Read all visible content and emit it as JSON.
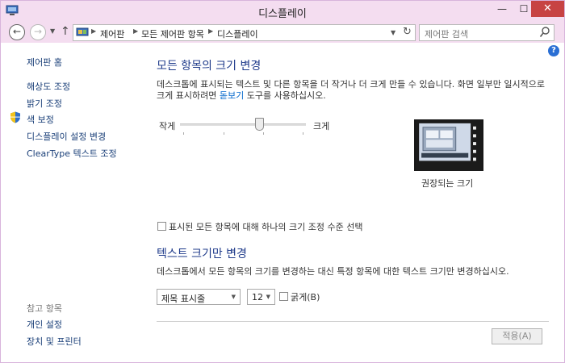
{
  "window": {
    "title": "디스플레이"
  },
  "titlebar_buttons": {
    "minimize": "—",
    "maximize": "☐",
    "close": "✕"
  },
  "nav": {
    "back": "←",
    "forward": "→",
    "up": "↑",
    "breadcrumb": [
      "제어판",
      "모든 제어판 항목",
      "디스플레이"
    ],
    "refresh": "↻",
    "search_placeholder": "제어판 검색"
  },
  "help": "?",
  "sidebar": {
    "home": "제어판 홈",
    "links": [
      "해상도 조정",
      "밝기 조정",
      "색 보정",
      "디스플레이 설정 변경",
      "ClearType 텍스트 조정"
    ],
    "see_also_heading": "참고 항목",
    "see_also": [
      "개인 설정",
      "장치 및 프린터"
    ]
  },
  "main": {
    "heading1": "모든 항목의 크기 변경",
    "desc1_line1": "데스크톱에 표시되는 텍스트 및 다른 항목을 더 작거나 더 크게 만들 수 있습니다. 화면 일부만 일시적으로",
    "desc1_line2_pre": "크게 표시하려면 ",
    "desc1_link": "돋보기",
    "desc1_line2_post": " 도구를 사용하십시오.",
    "slider_min_label": "작게",
    "slider_max_label": "크게",
    "slider_value_fraction": 0.63,
    "preview_caption": "권장되는 크기",
    "custom_scale_checkbox": "표시된 모든 항목에 대해 하나의 크기 조정 수준 선택",
    "heading2": "텍스트 크기만 변경",
    "desc2": "데스크톱에서 모든 항목의 크기를 변경하는 대신 특정 항목에 대한 텍스트 크기만 변경하십시오.",
    "item_select": "제목 표시줄",
    "size_select": "12",
    "bold_label": "굵게(B)",
    "apply": "적용(A)"
  },
  "colors": {
    "titlebar": "#f4ddf0",
    "heading": "#1e3a8a",
    "link": "#1a3f78",
    "close": "#c74343"
  }
}
